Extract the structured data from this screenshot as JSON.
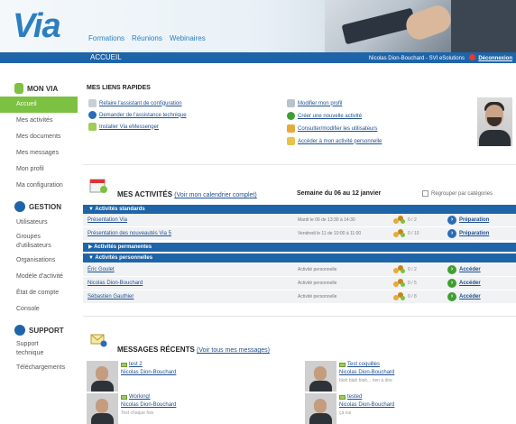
{
  "header": {
    "logo_text": "Via",
    "logo_tagline": "",
    "nav": [
      "Formations",
      "Réunions",
      "Webinaires"
    ]
  },
  "bluebar": {
    "crumb": "ACCUEIL",
    "user": "Nicolas Dion-Bouchard - SVI eSolutions",
    "logout": "Déconnexion"
  },
  "sidebar": {
    "sections": [
      {
        "title": "MON VIA",
        "icon": "person-icon",
        "items": [
          "Accueil",
          "Mes activités",
          "Mes documents",
          "Mes messages",
          "Mon profil",
          "Ma configuration"
        ]
      },
      {
        "title": "GESTION",
        "icon": "gear-icon",
        "items": [
          "Utilisateurs",
          "Groupes d'utilisateurs",
          "Organisations",
          "Modèle d'activité",
          "État de compte",
          "Console"
        ]
      },
      {
        "title": "SUPPORT",
        "icon": "help-icon",
        "items": [
          "Support technique",
          "Téléchargements"
        ]
      }
    ],
    "active_item": "Accueil"
  },
  "quick_links": {
    "title": "MES LIENS RAPIDES",
    "left": [
      {
        "label": "Refaire l'assistant de configuration",
        "icon": "wizard-icon"
      },
      {
        "label": "Demander de l'assistance technique",
        "icon": "help-icon"
      },
      {
        "label": "Installer Via eMessenger",
        "icon": "messenger-icon"
      }
    ],
    "right": [
      {
        "label": "Modifier mon profil",
        "icon": "profile-edit-icon"
      },
      {
        "label": "Créer une nouvelle activité",
        "icon": "add-icon"
      },
      {
        "label": "Consulter/modifier les utilisateurs",
        "icon": "users-icon"
      },
      {
        "label": "Accéder à mon activité personnelle",
        "icon": "calendar-icon"
      }
    ]
  },
  "activities": {
    "title": "MES ACTIVITÉS",
    "calendar_link": "(Voir mon calendrier complet)",
    "week": "Semaine du 06 au 12 janvier",
    "regroup_label": "Regrouper par catégories",
    "categories": [
      {
        "name": "Activités standards",
        "expanded": true,
        "rows": [
          {
            "name": "Présentation Via",
            "when": "Mardi le 06 de 13:30 à 14:30",
            "count": "0 / 2",
            "action": "Préparation",
            "action_type": "prepare"
          },
          {
            "name": "Présentation des nouveautés Via 5",
            "when": "Vendredi le 11 de 10:00 à 11:00",
            "count": "0 / 10",
            "action": "Préparation",
            "action_type": "prepare"
          }
        ]
      },
      {
        "name": "Activités permanentes",
        "expanded": false,
        "rows": []
      },
      {
        "name": "Activités personnelles",
        "expanded": true,
        "rows": [
          {
            "name": "Éric Goulet",
            "when": "Activité personnelle",
            "count": "0 / 2",
            "action": "Accéder",
            "action_type": "access"
          },
          {
            "name": "Nicolas Dion-Bouchard",
            "when": "Activité personnelle",
            "count": "0 / 5",
            "action": "Accéder",
            "action_type": "access"
          },
          {
            "name": "Sébastien Gauthier",
            "when": "Activité personnelle",
            "count": "0 / 8",
            "action": "Accéder",
            "action_type": "access"
          }
        ]
      }
    ]
  },
  "messages": {
    "title": "MESSAGES RÉCENTS",
    "all_link": "(Voir tous mes messages)",
    "items": [
      {
        "subject": "test 2",
        "from": "Nicolas Dion-Bouchard",
        "snippet": ""
      },
      {
        "subject": "Test coquilles",
        "from": "Nicolas Dion-Bouchard",
        "snippet": "blah blah blah... rien à dire"
      },
      {
        "subject": "Working!",
        "from": "Nicolas Dion-Bouchard",
        "snippet": "Test chaque fois"
      },
      {
        "subject": "tested",
        "from": "Nicolas Dion-Bouchard",
        "snippet": "ça oui"
      }
    ]
  },
  "colors": {
    "primary_blue": "#1e64a8",
    "accent_green": "#7cc142",
    "link": "#1f4f8f"
  }
}
